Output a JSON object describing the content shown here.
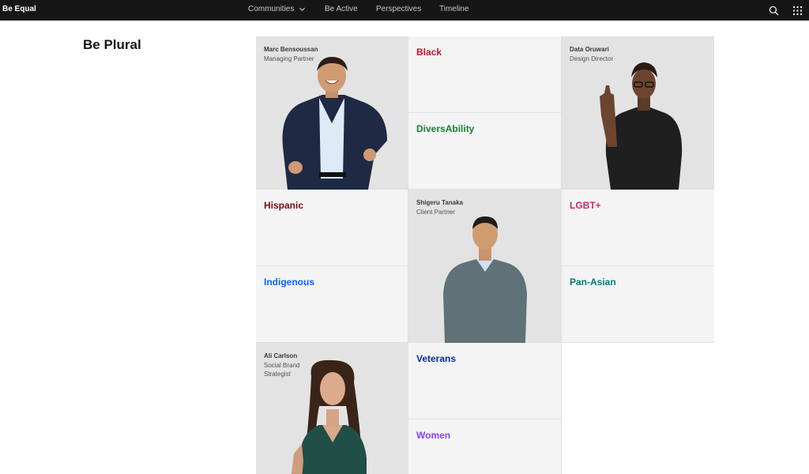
{
  "nav": {
    "brand": "Be Equal",
    "links": [
      "Communities",
      "Be Active",
      "Perspectives",
      "Timeline"
    ]
  },
  "page": {
    "title": "Be Plural"
  },
  "people": [
    {
      "name": "Marc Bensoussan",
      "role": "Managing Partner"
    },
    {
      "name": "Data Oruwari",
      "role": "Design Director"
    },
    {
      "name": "Shigeru Tanaka",
      "role": "Client Partner"
    },
    {
      "name": "Ali Carlson",
      "role": "Social Brand Strategist"
    }
  ],
  "communities": [
    {
      "label": "Black",
      "color": "#c4162a"
    },
    {
      "label": "DiversAbility",
      "color": "#198038"
    },
    {
      "label": "Hispanic",
      "color": "#750e13"
    },
    {
      "label": "LGBT+",
      "color": "#d02670"
    },
    {
      "label": "Indigenous",
      "color": "#0f62fe"
    },
    {
      "label": "Pan-Asian",
      "color": "#007d79"
    },
    {
      "label": "Veterans",
      "color": "#002d9c"
    },
    {
      "label": "Women",
      "color": "#8a3ffc"
    }
  ],
  "icons": {
    "search": "search-icon",
    "app_switcher": "app-switcher-icon",
    "chevron": "chevron-down-icon"
  }
}
